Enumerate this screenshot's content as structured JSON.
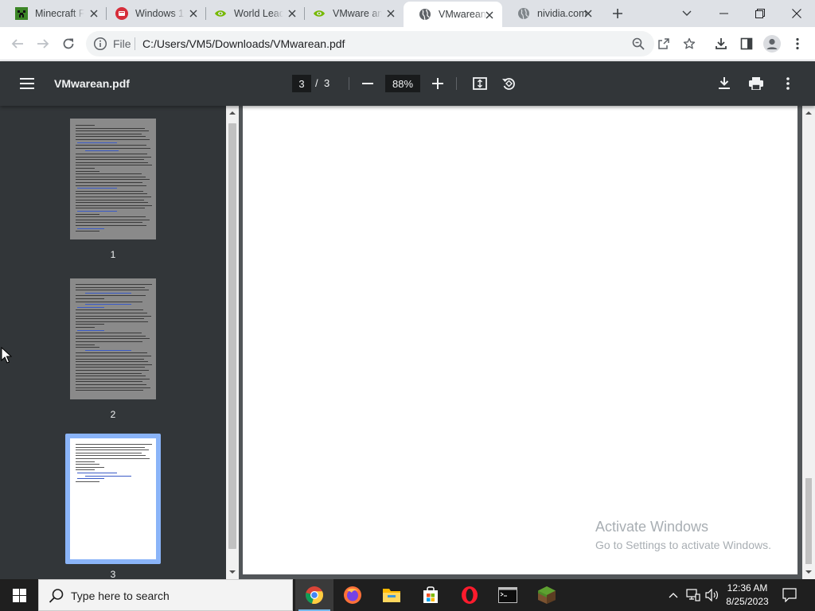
{
  "browser": {
    "tabs": [
      {
        "title": "Minecraft F",
        "icon": "minecraft-icon",
        "active": false
      },
      {
        "title": "Windows 1",
        "icon": "windows-report-icon",
        "active": false
      },
      {
        "title": "World Lead",
        "icon": "nvidia-icon",
        "active": false
      },
      {
        "title": "VMware an",
        "icon": "nvidia-icon",
        "active": false
      },
      {
        "title": "VMwarean.",
        "icon": "globe-icon",
        "active": true
      },
      {
        "title": "nividia.com",
        "icon": "globe-icon",
        "active": false
      }
    ],
    "address": {
      "scheme_label": "File",
      "url": "C:/Users/VM5/Downloads/VMwarean.pdf"
    }
  },
  "pdf_viewer": {
    "filename": "VMwarean.pdf",
    "current_page": "3",
    "page_separator": "/",
    "total_pages": "3",
    "zoom": "88%",
    "thumbnails": [
      {
        "number": "1",
        "selected": false
      },
      {
        "number": "2",
        "selected": false
      },
      {
        "number": "3",
        "selected": true
      }
    ]
  },
  "watermark": {
    "line1": "Activate Windows",
    "line2": "Go to Settings to activate Windows."
  },
  "taskbar": {
    "search_placeholder": "Type here to search",
    "apps": [
      "chrome-icon",
      "firefox-icon",
      "file-explorer-icon",
      "microsoft-store-icon",
      "opera-icon",
      "terminal-icon",
      "minecraft-icon"
    ],
    "time": "12:36 AM",
    "date": "8/25/2023"
  },
  "colors": {
    "pdf_toolbar": "#323639",
    "sidebar": "#323639",
    "selected_thumbnail_border": "#8ab4f8",
    "taskbar": "#1f1f1f"
  }
}
